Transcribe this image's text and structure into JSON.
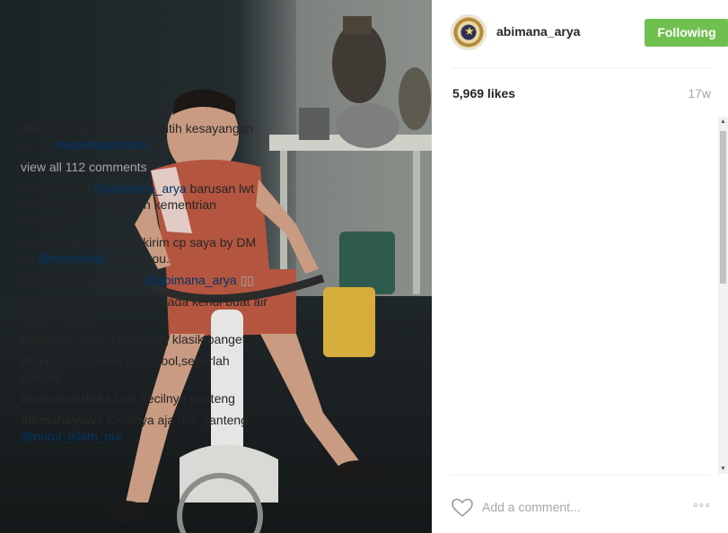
{
  "post": {
    "image_description_icon": "photo-icon"
  },
  "header": {
    "username": "abimana_arya",
    "follow_label": "Following"
  },
  "stats": {
    "likes": "5,969 likes",
    "age": "17w"
  },
  "caption": {
    "user": "abimana_arya",
    "text": "Sepeda putih kesayangan ku ☺",
    "hashtag": "#sepedapertama"
  },
  "view_all": "view all 112 comments",
  "comments": [
    {
      "user": "sahieel",
      "pre": "Mas",
      "tag": "@abimana_arya",
      "post": "barusan lwt daerah ragunan ya dpn kementrian pertanian"
    },
    {
      "user": "inong_ayu",
      "pre": "Saya sdh kirim cp saya by DM ya",
      "tag": "@mirasahid",
      "post": ",thank you."
    },
    {
      "user": "isnaamaliads",
      "pre": "Gagah",
      "tag": "@abimana_arya",
      "post": "▯▯"
    },
    {
      "user": "bayubalerina",
      "pre": "Wah masih ada kendi buat air minum, seger",
      "tag": "",
      "post": ""
    },
    {
      "user": "itiaja",
      "pre": "Mas teko d belakang klasik banget...",
      "tag": "",
      "post": ""
    },
    {
      "user": "itiaja",
      "pre": "Airnya adem pooooool,segerlah pokoke",
      "tag": "",
      "post": ""
    },
    {
      "user": "amaliasanthika",
      "pre": "Duh kecilnya ganteng",
      "tag": "",
      "post": ""
    },
    {
      "user": "hikmahayuws",
      "pre": "Kecilnya aja udh ganteng",
      "tag": "@nurul_islam_nui",
      "post": ""
    }
  ],
  "footer": {
    "comment_placeholder": "Add a comment...",
    "heart_icon": "heart-icon",
    "more_icon": "more-options-icon",
    "more_glyph": "◦◦◦"
  },
  "scrollbar": {
    "up_glyph": "▲",
    "down_glyph": "▼"
  },
  "colors": {
    "follow_green": "#70c050",
    "link_blue": "#003569",
    "muted_gray": "#a5a7aa"
  }
}
